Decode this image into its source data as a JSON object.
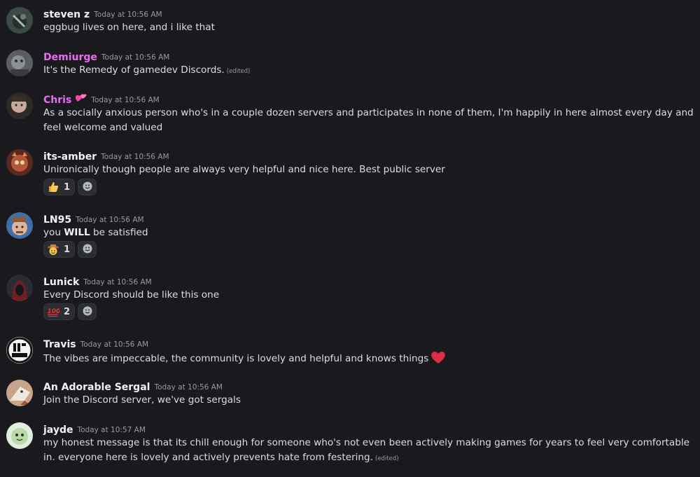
{
  "messages": [
    {
      "author": "steven z",
      "timestamp": "Today at 10:56 AM",
      "text": "eggbug lives on here, and i like that"
    },
    {
      "author": "Demiurge",
      "timestamp": "Today at 10:56 AM",
      "text": "It's the Remedy of gamedev Discords.",
      "edited": "(edited)",
      "author_color": "#ed6af5"
    },
    {
      "author": "Chris",
      "timestamp": "Today at 10:56 AM",
      "text": "As a socially anxious person who's in a couple dozen servers and participates in none of them, I'm happily in here almost every day and feel welcome and valued",
      "author_color": "#ed6af5",
      "badge": "two-hearts"
    },
    {
      "author": "its-amber",
      "timestamp": "Today at 10:56 AM",
      "text": "Unironically though people are always very helpful and nice here. Best public server",
      "reactions": [
        {
          "emoji": "thumbs-up",
          "count": "1"
        }
      ]
    },
    {
      "author": "LN95",
      "timestamp": "Today at 10:56 AM",
      "text_pre": "you ",
      "text_bold": "WILL",
      "text_post": " be satisfied",
      "reactions": [
        {
          "emoji": "cowboy-face",
          "count": "1"
        }
      ]
    },
    {
      "author": "Lunick",
      "timestamp": "Today at 10:56 AM",
      "text": "Every Discord should be like this one",
      "reactions": [
        {
          "emoji": "hundred-points",
          "count": "2"
        }
      ]
    },
    {
      "author": "Travis",
      "timestamp": "Today at 10:56 AM",
      "text": "The vibes are impeccable, the community is lovely and helpful and knows things",
      "inline_emoji": "red-heart"
    },
    {
      "author": "An Adorable Sergal",
      "timestamp": "Today at 10:56 AM",
      "text": "Join the Discord server, we've got sergals"
    },
    {
      "author": "jayde",
      "timestamp": "Today at 10:57 AM",
      "text": "my honest message is that its chill enough for someone who's not even been actively making games for years to feel very comfortable in. everyone here is lovely and actively prevents hate from festering.",
      "edited": "(edited)"
    }
  ],
  "colors": {
    "background": "#1a1a1e",
    "author": "#f2f3f5",
    "author_role": "#ed6af5",
    "timestamp": "#949ba4",
    "text": "#dbdee1",
    "reaction_bg": "#2b2d31"
  }
}
